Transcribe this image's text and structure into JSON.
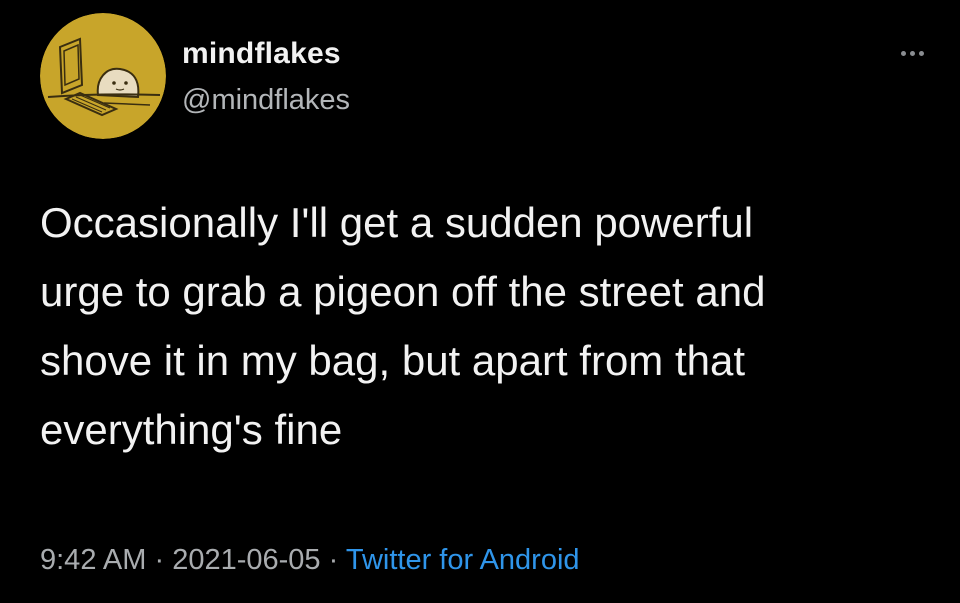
{
  "author": {
    "display_name": "mindflakes",
    "handle": "@mindflakes"
  },
  "tweet": {
    "lines": [
      "Occasionally I'll get a sudden powerful",
      "urge to grab a pigeon off the street and",
      "shove it in my bag, but apart from that",
      "everything's fine"
    ]
  },
  "meta": {
    "time": "9:42 AM",
    "separator": "·",
    "date": "2021-06-05",
    "source": "Twitter for Android"
  },
  "icons": {
    "more": "more-options-icon",
    "avatar": "avatar-illustration"
  },
  "colors": {
    "background": "#000000",
    "text": "#f2f2f2",
    "muted": "#a9acaf",
    "link": "#2f95ea",
    "avatar_bg": "#c8a52a"
  }
}
